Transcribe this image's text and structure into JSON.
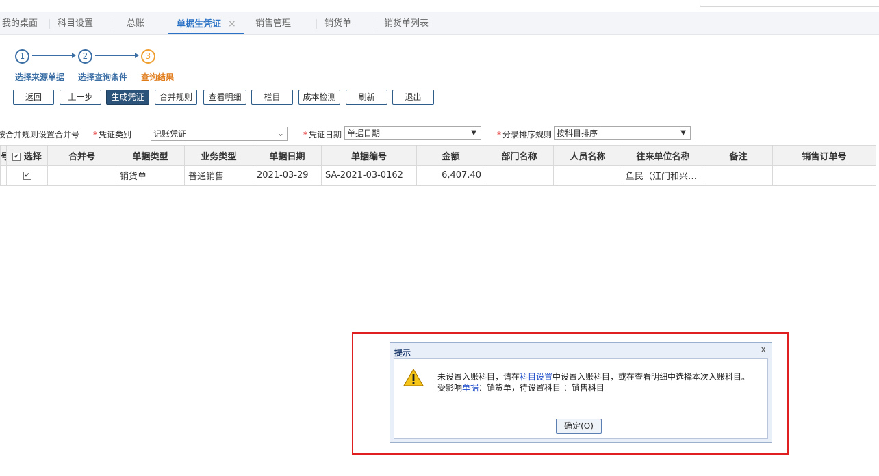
{
  "tabs": [
    {
      "label": "我的桌面",
      "active": false
    },
    {
      "label": "科目设置",
      "active": false
    },
    {
      "label": "总账",
      "active": false
    },
    {
      "label": "单据生凭证",
      "active": true,
      "close": "×"
    },
    {
      "label": "销售管理",
      "active": false
    },
    {
      "label": "销货单",
      "active": false
    },
    {
      "label": "销货单列表",
      "active": false
    }
  ],
  "steps": [
    {
      "num": "1",
      "label": "选择来源单据"
    },
    {
      "num": "2",
      "label": "选择查询条件"
    },
    {
      "num": "3",
      "label": "查询结果"
    }
  ],
  "toolbar": [
    "返回",
    "上一步",
    "生成凭证",
    "合并规则",
    "查看明细",
    "栏目",
    "成本检测",
    "刷新",
    "退出"
  ],
  "filters": {
    "merge_note": "按合并规则设置合并号",
    "voucher_type_label": "凭证类别",
    "voucher_type_value": "记账凭证",
    "voucher_date_label": "凭证日期",
    "voucher_date_value": "单据日期",
    "sort_label": "分录排序规则",
    "sort_value": "按科目排序"
  },
  "grid": {
    "headers": [
      "号",
      "选择",
      "合并号",
      "单据类型",
      "业务类型",
      "单据日期",
      "单据编号",
      "金额",
      "部门名称",
      "人员名称",
      "往来单位名称",
      "备注",
      "销售订单号"
    ],
    "rows": [
      {
        "merge": "",
        "doc_type": "销货单",
        "biz_type": "普通销售",
        "date": "2021-03-29",
        "doc_no": "SA-2021-03-0162",
        "amount": "6,407.40",
        "dept": "",
        "person": "",
        "partner": "鱼民（江门和兴…",
        "note": "",
        "so_no": ""
      }
    ]
  },
  "dialog": {
    "title": "提示",
    "close": "x",
    "line1_a": "未设置入账科目，请在",
    "line1_link": "科目设置",
    "line1_b": "中设置入账科目，或在查看明细中选择本次入账科目。",
    "line2_a": "受影响",
    "line2_link": "单据",
    "line2_b": "：销货单，待设置科目 ：销售科目",
    "ok": "确定(O)"
  }
}
